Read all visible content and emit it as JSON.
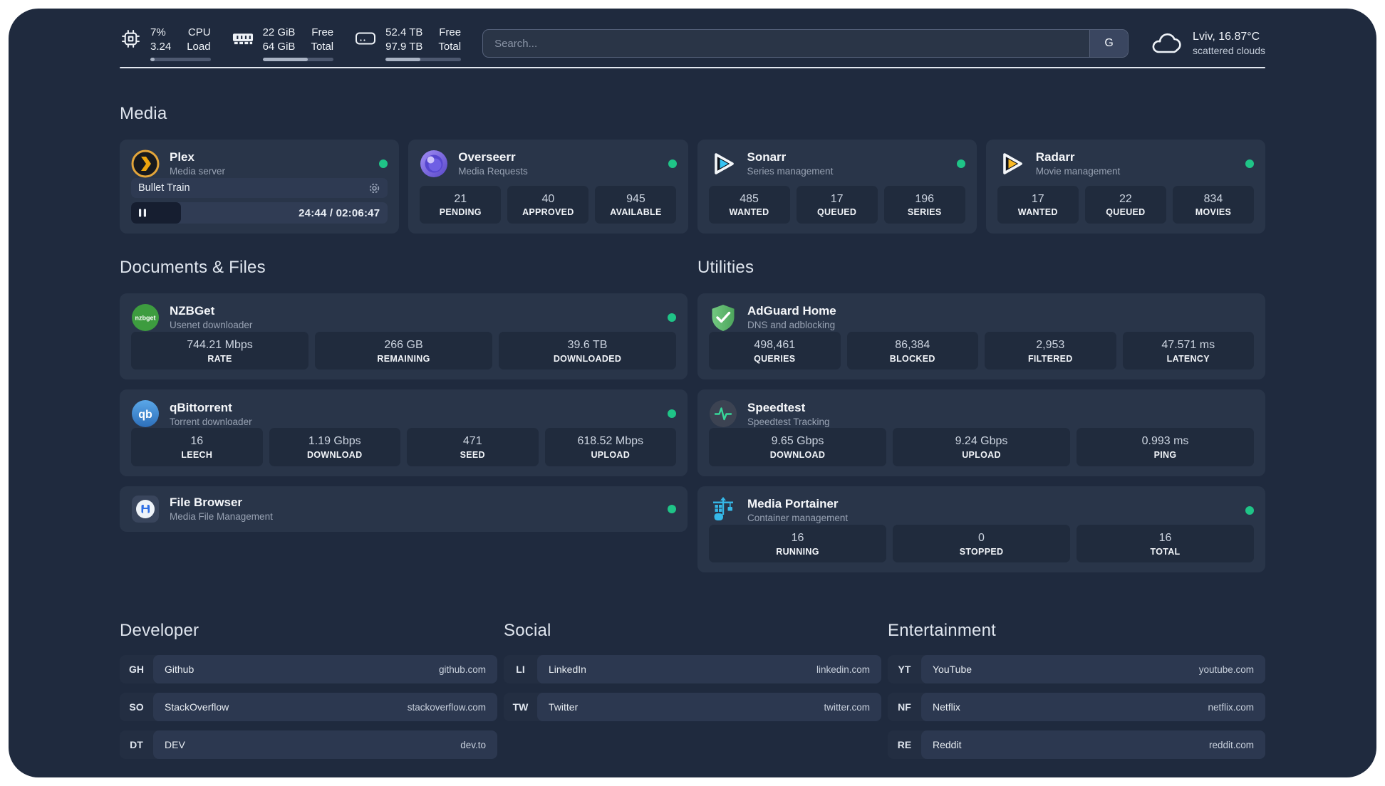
{
  "colors": {
    "page_bg": "#1f2a3e",
    "card_bg": "#293549",
    "tile_bg": "#202b3d",
    "status_online": "#1fc487",
    "plex_gold": "#eda50e",
    "sonarr_blue": "#36c3f2",
    "radarr_yellow": "#f9b924",
    "adguard_green": "#5fb96d",
    "speedtest_green": "#37d89a",
    "portainer_blue": "#35b8e8"
  },
  "header": {
    "cpu": {
      "line1_value": "7%",
      "line2_value": "3.24",
      "line1_label": "CPU",
      "line2_label": "Load",
      "progress_pct": 7
    },
    "ram": {
      "line1_value": "22 GiB",
      "line2_value": "64 GiB",
      "line1_label": "Free",
      "line2_label": "Total",
      "progress_pct": 64
    },
    "disk": {
      "line1_value": "52.4 TB",
      "line2_value": "97.9 TB",
      "line1_label": "Free",
      "line2_label": "Total",
      "progress_pct": 46
    },
    "search": {
      "placeholder": "Search...",
      "button_label": "G"
    },
    "weather": {
      "location": "Lviv, 16.87°C",
      "condition": "scattered clouds"
    }
  },
  "media": {
    "title": "Media",
    "plex": {
      "title": "Plex",
      "subtitle": "Media server",
      "now_playing": "Bullet Train",
      "time": "24:44 / 02:06:47",
      "progress_pct": 19.5
    },
    "overseerr": {
      "title": "Overseerr",
      "subtitle": "Media Requests",
      "stats": [
        {
          "value": "21",
          "label": "PENDING"
        },
        {
          "value": "40",
          "label": "APPROVED"
        },
        {
          "value": "945",
          "label": "AVAILABLE"
        }
      ]
    },
    "sonarr": {
      "title": "Sonarr",
      "subtitle": "Series management",
      "stats": [
        {
          "value": "485",
          "label": "WANTED"
        },
        {
          "value": "17",
          "label": "QUEUED"
        },
        {
          "value": "196",
          "label": "SERIES"
        }
      ]
    },
    "radarr": {
      "title": "Radarr",
      "subtitle": "Movie management",
      "stats": [
        {
          "value": "17",
          "label": "WANTED"
        },
        {
          "value": "22",
          "label": "QUEUED"
        },
        {
          "value": "834",
          "label": "MOVIES"
        }
      ]
    }
  },
  "documents": {
    "title": "Documents & Files",
    "nzbget": {
      "title": "NZBGet",
      "subtitle": "Usenet downloader",
      "stats": [
        {
          "value": "744.21 Mbps",
          "label": "RATE"
        },
        {
          "value": "266 GB",
          "label": "REMAINING"
        },
        {
          "value": "39.6 TB",
          "label": "DOWNLOADED"
        }
      ]
    },
    "qbittorrent": {
      "title": "qBittorrent",
      "subtitle": "Torrent downloader",
      "stats": [
        {
          "value": "16",
          "label": "LEECH"
        },
        {
          "value": "1.19 Gbps",
          "label": "DOWNLOAD"
        },
        {
          "value": "471",
          "label": "SEED"
        },
        {
          "value": "618.52 Mbps",
          "label": "UPLOAD"
        }
      ]
    },
    "filebrowser": {
      "title": "File Browser",
      "subtitle": "Media File Management"
    }
  },
  "utilities": {
    "title": "Utilities",
    "adguard": {
      "title": "AdGuard Home",
      "subtitle": "DNS and adblocking",
      "stats": [
        {
          "value": "498,461",
          "label": "QUERIES"
        },
        {
          "value": "86,384",
          "label": "BLOCKED"
        },
        {
          "value": "2,953",
          "label": "FILTERED"
        },
        {
          "value": "47.571 ms",
          "label": "LATENCY"
        }
      ]
    },
    "speedtest": {
      "title": "Speedtest",
      "subtitle": "Speedtest Tracking",
      "stats": [
        {
          "value": "9.65 Gbps",
          "label": "DOWNLOAD"
        },
        {
          "value": "9.24 Gbps",
          "label": "UPLOAD"
        },
        {
          "value": "0.993 ms",
          "label": "PING"
        }
      ]
    },
    "portainer": {
      "title": "Media Portainer",
      "subtitle": "Container management",
      "stats": [
        {
          "value": "16",
          "label": "RUNNING"
        },
        {
          "value": "0",
          "label": "STOPPED"
        },
        {
          "value": "16",
          "label": "TOTAL"
        }
      ]
    }
  },
  "links": {
    "developer": {
      "title": "Developer",
      "items": [
        {
          "abbr": "GH",
          "name": "Github",
          "url": "github.com"
        },
        {
          "abbr": "SO",
          "name": "StackOverflow",
          "url": "stackoverflow.com"
        },
        {
          "abbr": "DT",
          "name": "DEV",
          "url": "dev.to"
        }
      ]
    },
    "social": {
      "title": "Social",
      "items": [
        {
          "abbr": "LI",
          "name": "LinkedIn",
          "url": "linkedin.com"
        },
        {
          "abbr": "TW",
          "name": "Twitter",
          "url": "twitter.com"
        }
      ]
    },
    "entertainment": {
      "title": "Entertainment",
      "items": [
        {
          "abbr": "YT",
          "name": "YouTube",
          "url": "youtube.com"
        },
        {
          "abbr": "NF",
          "name": "Netflix",
          "url": "netflix.com"
        },
        {
          "abbr": "RE",
          "name": "Reddit",
          "url": "reddit.com"
        }
      ]
    }
  }
}
